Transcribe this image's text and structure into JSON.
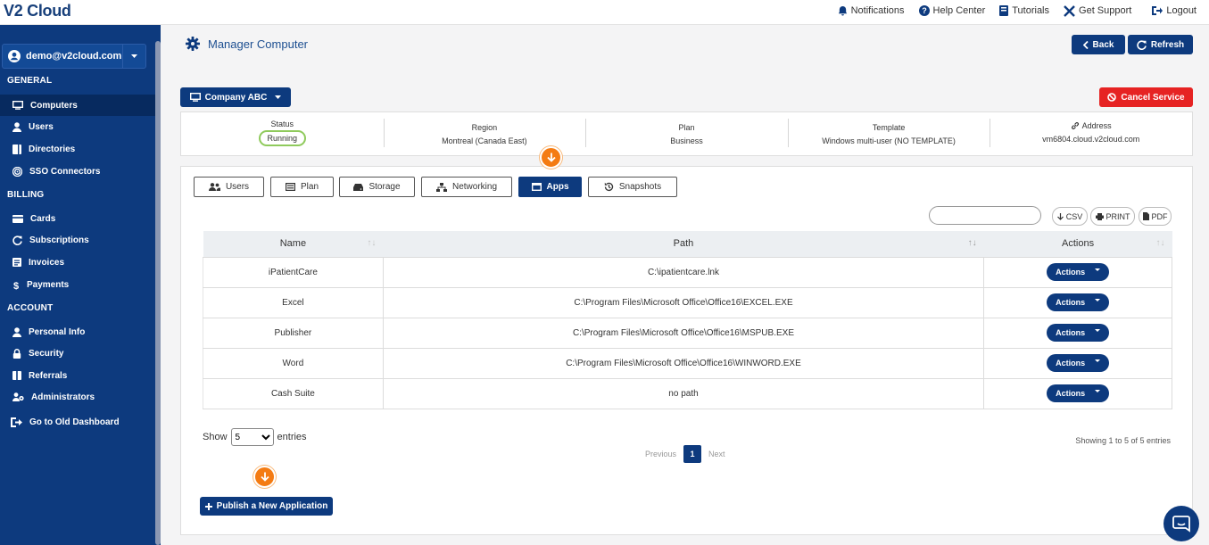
{
  "app": {
    "logo": "V2 Cloud"
  },
  "topnav": {
    "notifications": "Notifications",
    "help_center": "Help Center",
    "tutorials": "Tutorials",
    "get_support": "Get Support",
    "logout": "Logout"
  },
  "sidebar": {
    "user": "demo@v2cloud.com",
    "sections": {
      "general": "GENERAL",
      "billing": "BILLING",
      "account": "ACCOUNT"
    },
    "items": {
      "computers": "Computers",
      "users": "Users",
      "directories": "Directories",
      "sso": "SSO Connectors",
      "cards": "Cards",
      "subscriptions": "Subscriptions",
      "invoices": "Invoices",
      "payments": "Payments",
      "personal_info": "Personal Info",
      "security": "Security",
      "referrals": "Referrals",
      "administrators": "Administrators",
      "old_dashboard": "Go to Old Dashboard"
    }
  },
  "header": {
    "title": "Manager Computer",
    "back": "Back",
    "refresh": "Refresh",
    "company": "Company ABC",
    "cancel_service": "Cancel Service"
  },
  "info": {
    "status_label": "Status",
    "status_value": "Running",
    "region_label": "Region",
    "region_value": "Montreal (Canada East)",
    "plan_label": "Plan",
    "plan_value": "Business",
    "template_label": "Template",
    "template_value": "Windows multi-user (NO TEMPLATE)",
    "address_label": "Address",
    "address_value": "vm6804.cloud.v2cloud.com"
  },
  "tabs": {
    "users": "Users",
    "plan": "Plan",
    "storage": "Storage",
    "networking": "Networking",
    "apps": "Apps",
    "snapshots": "Snapshots"
  },
  "toolbar": {
    "search_placeholder": "",
    "csv": "CSV",
    "print": "PRINT",
    "pdf": "PDF"
  },
  "table": {
    "headers": {
      "name": "Name",
      "path": "Path",
      "actions": "Actions"
    },
    "rows": [
      {
        "name": "iPatientCare",
        "path": "C:\\ipatientcare.lnk",
        "action": "Actions"
      },
      {
        "name": "Excel",
        "path": "C:\\Program Files\\Microsoft Office\\Office16\\EXCEL.EXE",
        "action": "Actions"
      },
      {
        "name": "Publisher",
        "path": "C:\\Program Files\\Microsoft Office\\Office16\\MSPUB.EXE",
        "action": "Actions"
      },
      {
        "name": "Word",
        "path": "C:\\Program Files\\Microsoft Office\\Office16\\WINWORD.EXE",
        "action": "Actions"
      },
      {
        "name": "Cash Suite",
        "path": "no path",
        "action": "Actions"
      }
    ]
  },
  "footer": {
    "show": "Show",
    "entries_value": "5",
    "entries": "entries",
    "showing": "Showing 1 to 5 of 5 entries",
    "previous": "Previous",
    "page": "1",
    "next": "Next",
    "publish": "Publish a New Application"
  },
  "colors": {
    "primary": "#0d3a7e",
    "danger": "#e62323",
    "highlight": "#f47b12",
    "running": "#8fca5c"
  }
}
